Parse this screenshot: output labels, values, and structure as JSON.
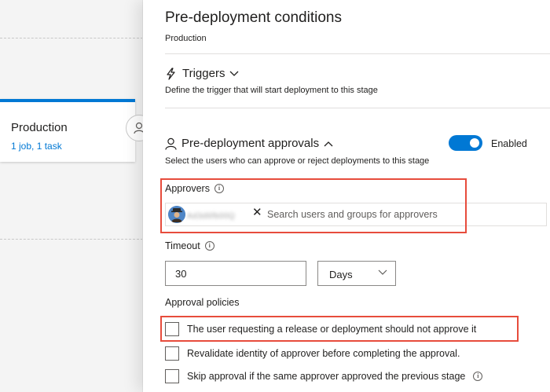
{
  "pipeline": {
    "stage": {
      "name": "Production",
      "summary": "1 job, 1 task"
    }
  },
  "panel": {
    "title": "Pre-deployment conditions",
    "subtitle": "Production",
    "triggers": {
      "title": "Triggers",
      "icon": "lightning-trigger-icon",
      "description": "Define the trigger that will start deployment to this stage"
    },
    "approvals": {
      "title": "Pre-deployment approvals",
      "icon": "person-icon",
      "description": "Select the users who can approve or reject deployments to this stage",
      "toggle": {
        "state": "on",
        "label": "Enabled",
        "color": "#0078d4"
      },
      "approvers": {
        "label": "Approvers",
        "selected_user": "Ad3d6fb00Q",
        "search_placeholder": "Search users and groups for approvers"
      },
      "timeout": {
        "label": "Timeout",
        "value": "30",
        "unit": "Days"
      },
      "policies": {
        "title": "Approval policies",
        "items": [
          {
            "label": "The user requesting a release or deployment should not approve it",
            "checked": false
          },
          {
            "label": "Revalidate identity of approver before completing the approval.",
            "checked": false
          },
          {
            "label": "Skip approval if the same approver approved the previous stage",
            "checked": false
          }
        ]
      }
    }
  },
  "colors": {
    "accent": "#0078d4",
    "highlight_box": "#e74c3c"
  }
}
